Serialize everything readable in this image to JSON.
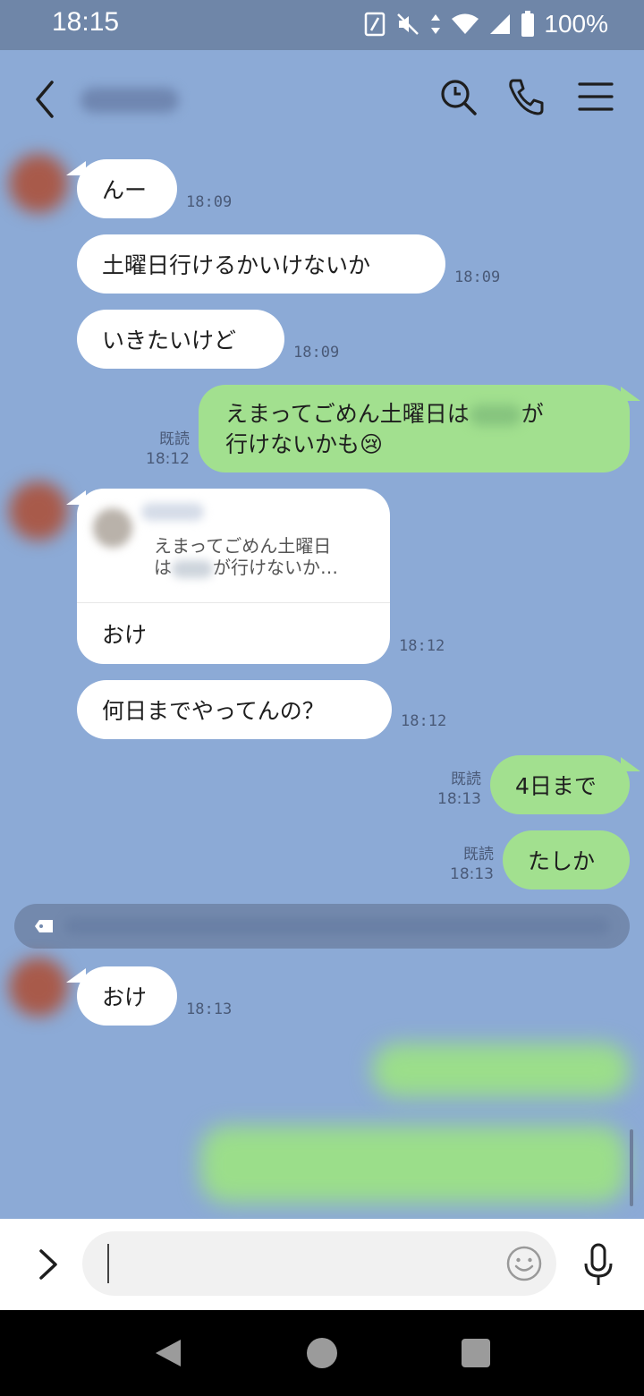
{
  "status_bar": {
    "time": "18:15",
    "battery": "100%"
  },
  "header": {
    "title": "",
    "icons": [
      "back-icon",
      "search-icon",
      "phone-icon",
      "menu-icon"
    ]
  },
  "messages": [
    {
      "side": "left",
      "text": "んー",
      "time": "18:09"
    },
    {
      "side": "left",
      "text": "土曜日行けるかいけないか",
      "time": "18:09"
    },
    {
      "side": "left",
      "text": "いきたいけど",
      "time": "18:09"
    },
    {
      "side": "right",
      "line1_a": "えまってごめん土曜日は",
      "line1_b": "が",
      "line2": "行けないかも😢",
      "read": "既読",
      "time": "18:12"
    },
    {
      "side": "left",
      "quote_line1": "えまってごめん土曜日",
      "quote_line2_a": "は",
      "quote_line2_b": "が行けないか…",
      "text": "おけ",
      "time": "18:12"
    },
    {
      "side": "left",
      "text": "何日までやってんの？",
      "time": "18:12"
    },
    {
      "side": "right",
      "text": "4日まで",
      "read": "既読",
      "time": "18:13"
    },
    {
      "side": "right",
      "text": "たしか",
      "read": "既読",
      "time": "18:13"
    },
    {
      "side": "left",
      "text": "おけ",
      "time": "18:13"
    }
  ],
  "input": {
    "placeholder": ""
  },
  "colors": {
    "background": "#8caad6",
    "incoming": "#ffffff",
    "outgoing": "#a2e08f",
    "status_bar": "#6f86a8"
  }
}
